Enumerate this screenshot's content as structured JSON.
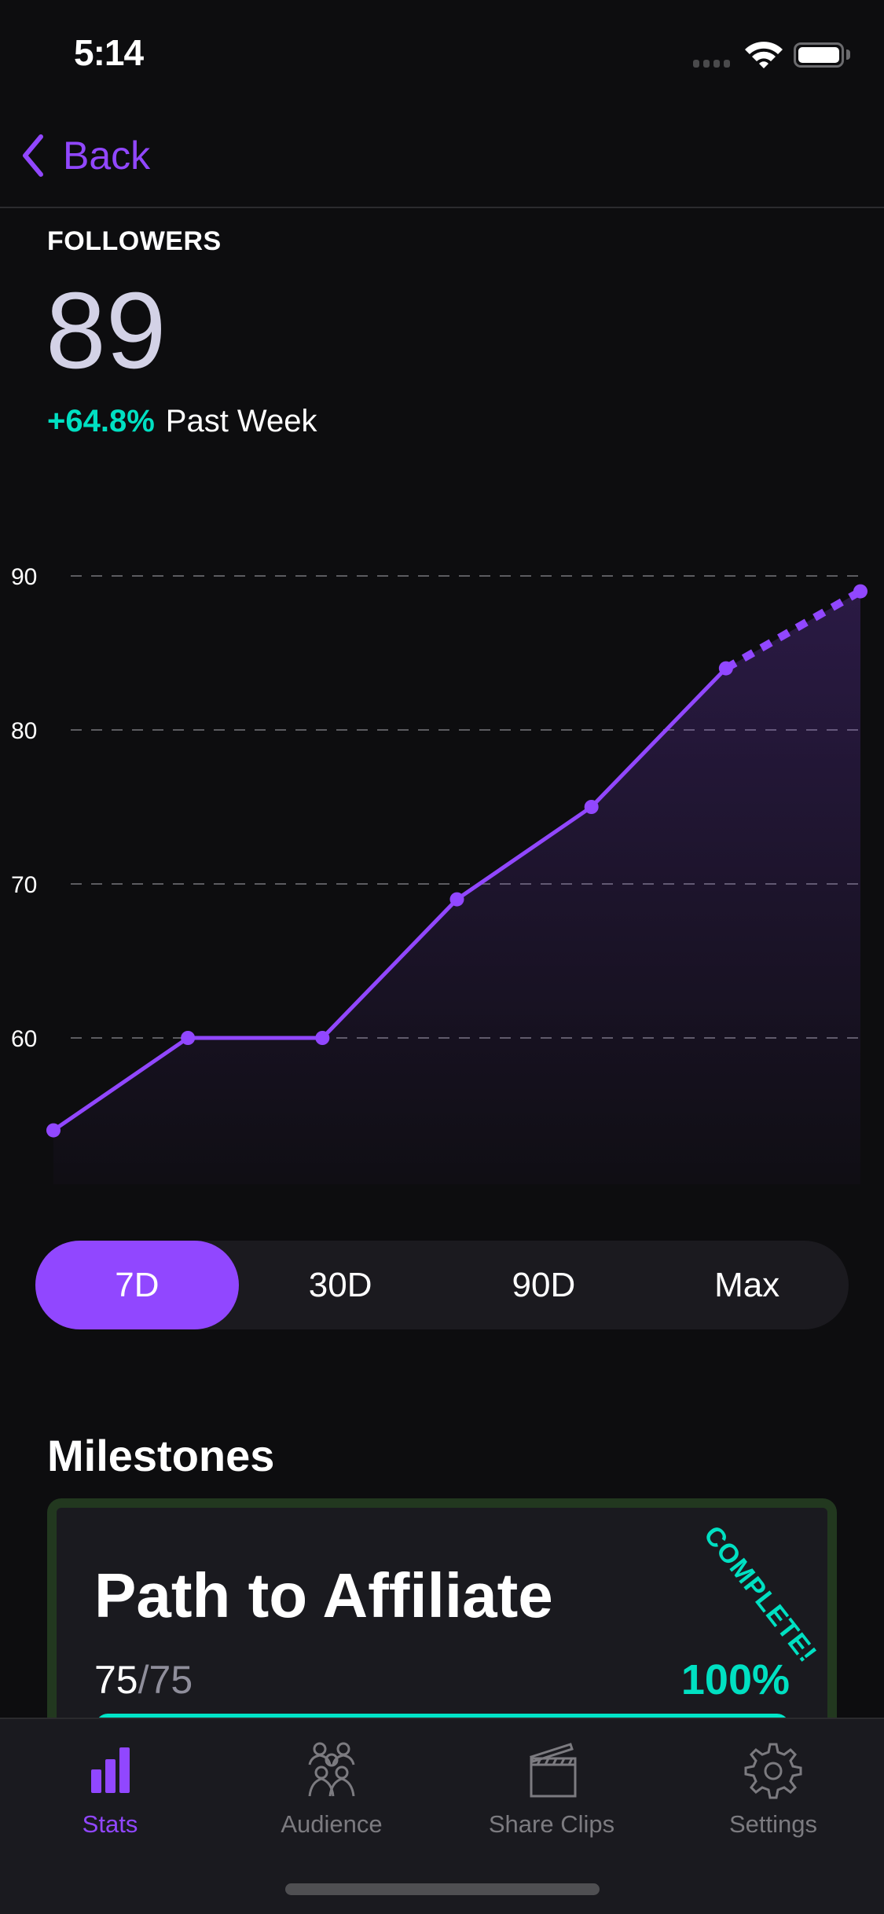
{
  "status_bar": {
    "time": "5:14",
    "icons": [
      "cellular-signal-icon",
      "wifi-icon",
      "battery-icon"
    ]
  },
  "nav": {
    "back_label": "Back"
  },
  "metric": {
    "label": "FOLLOWERS",
    "value": "89",
    "change_pct": "+64.8%",
    "change_period": "Past Week"
  },
  "colors": {
    "accent": "#9147ff",
    "positive": "#00e0c2",
    "card_border": "#22381f"
  },
  "chart_data": {
    "type": "line",
    "title": "",
    "xlabel": "",
    "ylabel": "",
    "x": [
      1,
      2,
      3,
      4,
      5,
      6,
      7
    ],
    "series": [
      {
        "name": "Followers",
        "values": [
          54,
          60,
          60,
          69,
          75,
          84,
          89
        ],
        "projected_from_index": 5
      }
    ],
    "y_ticks": [
      60,
      70,
      80,
      90
    ],
    "y_tick_labels": [
      "60",
      "70",
      "80",
      "90"
    ],
    "ylim": [
      50.5,
      91
    ],
    "grid": true,
    "grid_style": "dashed",
    "area_fill": true,
    "legend": "none"
  },
  "range_selector": {
    "options": [
      "7D",
      "30D",
      "90D",
      "Max"
    ],
    "selected": "7D"
  },
  "milestones": {
    "title": "Milestones",
    "items": [
      {
        "title": "Path to Affiliate",
        "current": "75",
        "separator": "/",
        "total": "75",
        "percent_label": "100%",
        "progress": 1.0,
        "badge": "COMPLETE!"
      }
    ]
  },
  "tabbar": {
    "items": [
      {
        "label": "Stats",
        "icon": "bar-chart-icon",
        "active": true
      },
      {
        "label": "Audience",
        "icon": "people-group-icon",
        "active": false
      },
      {
        "label": "Share Clips",
        "icon": "clapperboard-icon",
        "active": false
      },
      {
        "label": "Settings",
        "icon": "gear-icon",
        "active": false
      }
    ]
  }
}
